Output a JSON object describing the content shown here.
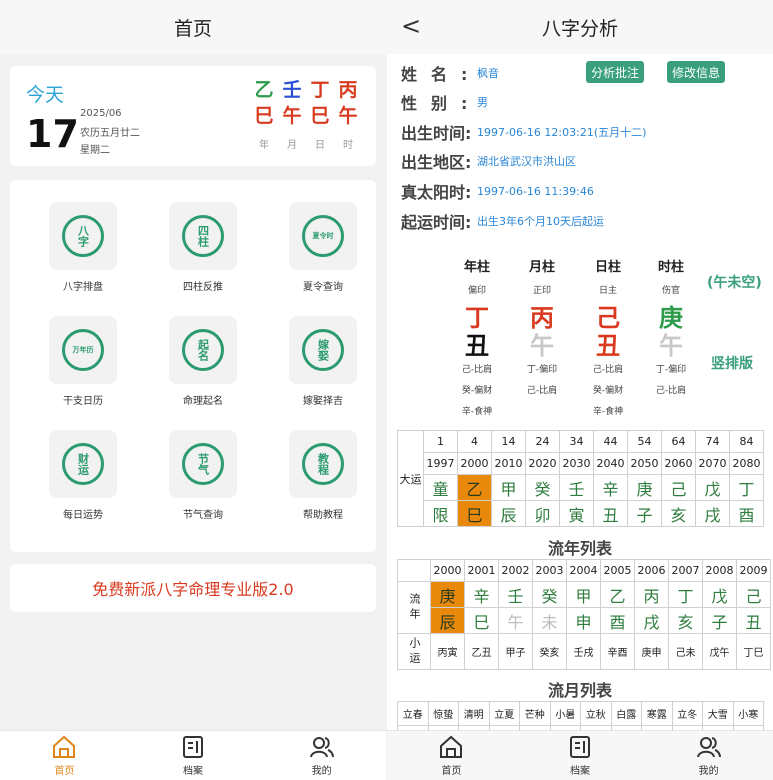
{
  "left": {
    "nav_title": "首页",
    "date_card": {
      "today_label": "今天",
      "day": "17",
      "year_month": "2025/06",
      "lunar": "农历五月廿二",
      "weekday": "星期二",
      "stems": [
        {
          "text": "乙",
          "color": "#2c9b4a"
        },
        {
          "text": "壬",
          "color": "#2a4fd6"
        },
        {
          "text": "丁",
          "color": "#d93a1f"
        },
        {
          "text": "丙",
          "color": "#d93a1f"
        }
      ],
      "branches": [
        {
          "text": "巳",
          "color": "#d93a1f"
        },
        {
          "text": "午",
          "color": "#d93a1f"
        },
        {
          "text": "巳",
          "color": "#d93a1f"
        },
        {
          "text": "午",
          "color": "#d93a1f"
        }
      ],
      "labels": [
        "年",
        "月",
        "日",
        "时"
      ]
    },
    "tiles": [
      {
        "icon": "八字",
        "label": "八字排盘"
      },
      {
        "icon": "四柱",
        "label": "四柱反推"
      },
      {
        "icon": "夏令时",
        "label": "夏令查询"
      },
      {
        "icon": "万年历",
        "label": "干支日历"
      },
      {
        "icon": "起名",
        "label": "命理起名"
      },
      {
        "icon": "嫁娶",
        "label": "嫁娶择吉"
      },
      {
        "icon": "财运",
        "label": "每日运势"
      },
      {
        "icon": "节气",
        "label": "节气查询"
      },
      {
        "icon": "教程",
        "label": "帮助教程"
      }
    ],
    "promo": "免费新派八字命理专业版2.0",
    "tabbar": [
      {
        "label": "首页",
        "active": true
      },
      {
        "label": "档案",
        "active": false
      },
      {
        "label": "我的",
        "active": false
      }
    ]
  },
  "right": {
    "nav_title": "八字分析",
    "back_glyph": "<",
    "info": {
      "name_label": "姓名:",
      "name": "枫音",
      "gender_label": "性别:",
      "gender": "男",
      "birth_time_label": "出生时间:",
      "birth_time": "1997-06-16 12:03:21(五月十二)",
      "birth_place_label": "出生地区:",
      "birth_place": "湖北省武汉市洪山区",
      "solar_time_label": "真太阳时:",
      "solar_time": "1997-06-16 11:39:46",
      "luck_start_label": "起运时间:",
      "luck_start": "出生3年6个月10天后起运"
    },
    "buttons": {
      "analysis": "分析批注",
      "edit": "修改信息"
    },
    "pillars": [
      {
        "title": "年柱",
        "god": "偏印",
        "stem": "丁",
        "stem_color": "#d93a1f",
        "branch": "丑",
        "branch_color": "#111111",
        "hidden": [
          "己-比肩",
          "癸-偏财",
          "辛-食神"
        ]
      },
      {
        "title": "月柱",
        "god": "正印",
        "stem": "丙",
        "stem_color": "#d93a1f",
        "branch": "午",
        "branch_color": "#c8c8c8",
        "hidden": [
          "丁-偏印",
          "己-比肩"
        ]
      },
      {
        "title": "日柱",
        "god": "日主",
        "stem": "己",
        "stem_color": "#d93a1f",
        "branch": "丑",
        "branch_color": "#d93a1f",
        "hidden": [
          "己-比肩",
          "癸-偏财",
          "辛-食神"
        ]
      },
      {
        "title": "时柱",
        "god": "伤官",
        "stem": "庚",
        "stem_color": "#2c9b4a",
        "branch": "午",
        "branch_color": "#c8c8c8",
        "hidden": [
          "丁-偏印",
          "己-比肩"
        ]
      }
    ],
    "kong": "(午未空)",
    "vertical_label": "竖排版",
    "dayun": {
      "label": "大运",
      "ages": [
        "1",
        "4",
        "14",
        "24",
        "34",
        "44",
        "54",
        "64",
        "74",
        "84"
      ],
      "years": [
        "1997",
        "2000",
        "2010",
        "2020",
        "2030",
        "2040",
        "2050",
        "2060",
        "2070",
        "2080"
      ],
      "top": [
        "童",
        "乙",
        "甲",
        "癸",
        "壬",
        "辛",
        "庚",
        "己",
        "戊",
        "丁"
      ],
      "bottom": [
        "限",
        "巳",
        "辰",
        "卯",
        "寅",
        "丑",
        "子",
        "亥",
        "戌",
        "酉"
      ]
    },
    "liunian_title": "流年列表",
    "liunian": {
      "label": "流年",
      "years": [
        "2000",
        "2001",
        "2002",
        "2003",
        "2004",
        "2005",
        "2006",
        "2007",
        "2008",
        "2009"
      ],
      "top": [
        "庚",
        "辛",
        "壬",
        "癸",
        "甲",
        "乙",
        "丙",
        "丁",
        "戊",
        "己"
      ],
      "bottom": [
        "辰",
        "巳",
        "午",
        "未",
        "申",
        "酉",
        "戌",
        "亥",
        "子",
        "丑"
      ],
      "gray_bottom": [
        2,
        3
      ]
    },
    "xiaoyun": {
      "label": "小运",
      "values": [
        "丙寅",
        "乙丑",
        "甲子",
        "癸亥",
        "壬戌",
        "辛酉",
        "庚申",
        "己未",
        "戊午",
        "丁巳"
      ]
    },
    "liuyue_title": "流月列表",
    "liuyue": [
      "立春",
      "惊蛰",
      "清明",
      "立夏",
      "芒种",
      "小暑",
      "立秋",
      "白露",
      "寒露",
      "立冬",
      "大雪",
      "小寒"
    ],
    "tabbar": [
      {
        "label": "首页"
      },
      {
        "label": "档案"
      },
      {
        "label": "我的"
      }
    ]
  }
}
